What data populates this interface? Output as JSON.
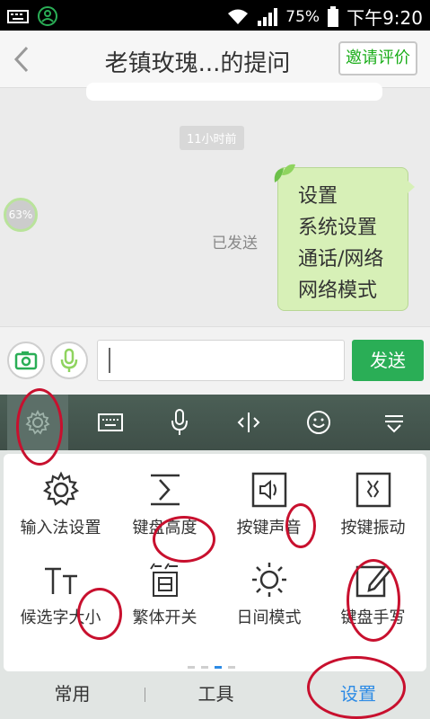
{
  "status_bar": {
    "battery": "75%",
    "time": "下午9:20",
    "icons": [
      "keyboard-icon",
      "contact-icon",
      "wifi-icon",
      "signal-icon",
      "battery-icon"
    ]
  },
  "header": {
    "title": "老镇玫瑰...的提问",
    "invite_label": "邀请评价"
  },
  "chat": {
    "timestamp": "11小时前",
    "progress": "63%",
    "sent_label": "已发送",
    "message_lines": [
      "设置",
      "系统设置",
      "通话/网络",
      "网络模式"
    ]
  },
  "input_bar": {
    "send_label": "发送",
    "input_value": ""
  },
  "keyboard_toolbar": {
    "tools": [
      "settings-icon",
      "keyboard-icon",
      "microphone-icon",
      "cursor-icon",
      "emoji-icon",
      "collapse-icon"
    ]
  },
  "settings_panel": {
    "items": [
      {
        "label": "输入法设置",
        "icon": "gear-icon"
      },
      {
        "label": "键盘高度",
        "icon": "keyboard-height-icon"
      },
      {
        "label": "按键声音",
        "icon": "key-sound-icon"
      },
      {
        "label": "按键振动",
        "icon": "key-vibration-icon"
      },
      {
        "label": "候选字大小",
        "icon": "font-size-icon"
      },
      {
        "label": "繁体开关",
        "icon": "traditional-chinese-icon"
      },
      {
        "label": "日间模式",
        "icon": "day-mode-icon"
      },
      {
        "label": "键盘手写",
        "icon": "handwriting-icon"
      }
    ],
    "tabs": [
      "常用",
      "工具",
      "设置"
    ],
    "active_tab": "设置"
  },
  "colors": {
    "accent_green": "#2aae56",
    "bubble_green": "#d7f0b7",
    "active_blue": "#2d8be5",
    "annotation_red": "#c8102e"
  }
}
